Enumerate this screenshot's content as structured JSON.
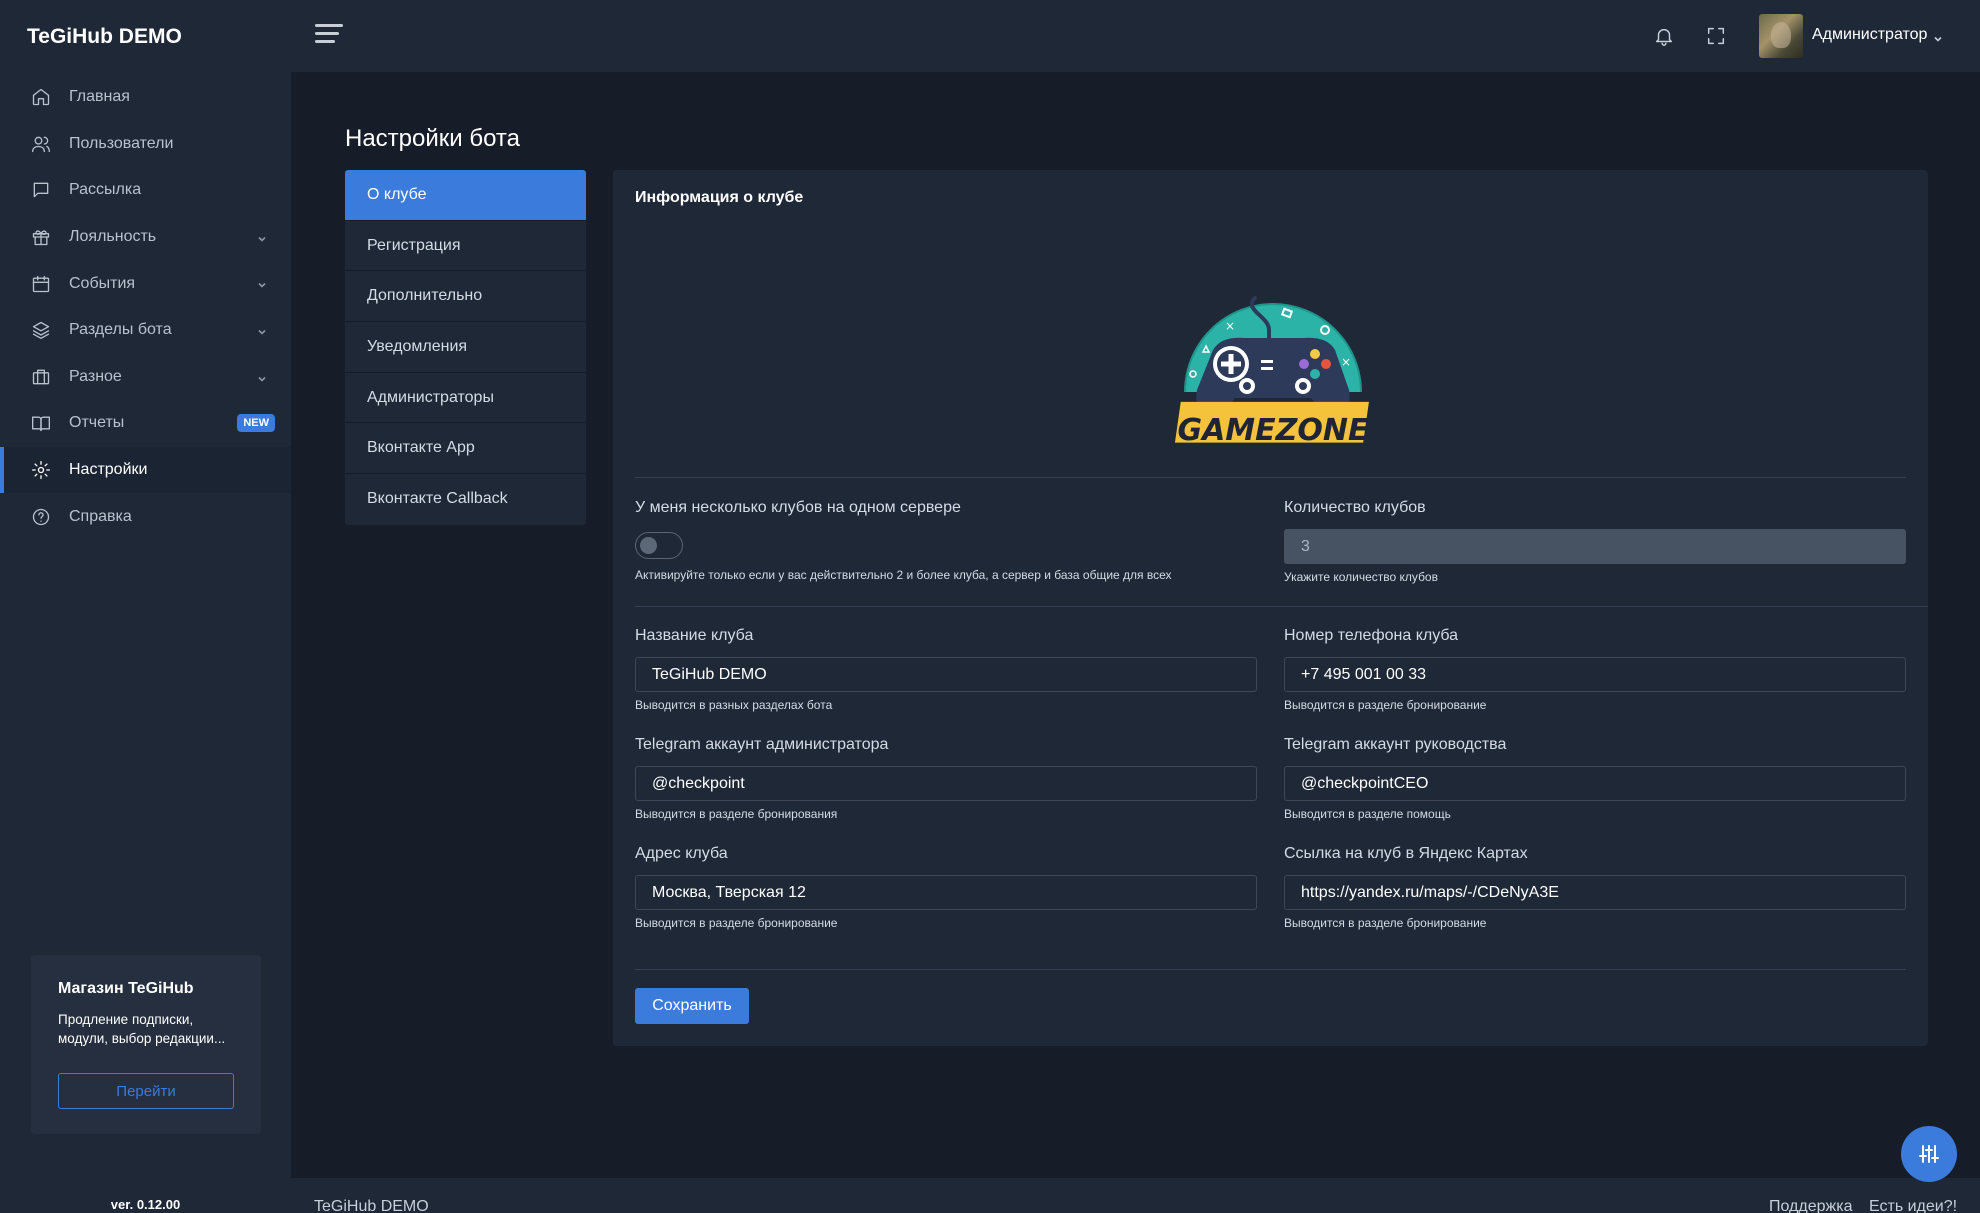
{
  "brand": "TeGiHub DEMO",
  "sidebar": {
    "items": [
      {
        "label": "Главная",
        "icon": "home-icon"
      },
      {
        "label": "Пользователи",
        "icon": "users-icon"
      },
      {
        "label": "Рассылка",
        "icon": "message-icon"
      },
      {
        "label": "Лояльность",
        "icon": "gift-icon",
        "expandable": true
      },
      {
        "label": "События",
        "icon": "calendar-icon",
        "expandable": true
      },
      {
        "label": "Разделы бота",
        "icon": "layers-icon",
        "expandable": true
      },
      {
        "label": "Разное",
        "icon": "briefcase-icon",
        "expandable": true
      },
      {
        "label": "Отчеты",
        "icon": "book-icon",
        "badge": "NEW"
      },
      {
        "label": "Настройки",
        "icon": "gear-icon",
        "active": true
      },
      {
        "label": "Справка",
        "icon": "help-icon"
      }
    ],
    "shop": {
      "title": "Магазин TeGiHub",
      "text": "Продление подписки, модули, выбор редакции...",
      "button": "Перейти"
    },
    "version": "ver. 0.12.00"
  },
  "topbar": {
    "user": "Администратор"
  },
  "page": {
    "title": "Настройки бота",
    "tabs": [
      {
        "label": "О клубе",
        "active": true
      },
      {
        "label": "Регистрация"
      },
      {
        "label": "Дополнительно"
      },
      {
        "label": "Уведомления"
      },
      {
        "label": "Администраторы"
      },
      {
        "label": "Вконтакте App"
      },
      {
        "label": "Вконтакте Callback"
      }
    ]
  },
  "card": {
    "title": "Информация о клубе",
    "logo_text": "GAMEZONE",
    "multi_club": {
      "label": "У меня несколько клубов на одном сервере",
      "hint": "Активируйте только если у вас действительно 2 и более клуба, а сервер и база общие для всех",
      "enabled": false
    },
    "club_count": {
      "label": "Количество клубов",
      "value": "3",
      "hint": "Укажите количество клубов"
    },
    "club_name": {
      "label": "Название клуба",
      "value": "TeGiHub DEMO",
      "hint": "Выводится в разных разделах бота"
    },
    "club_phone": {
      "label": "Номер телефона клуба",
      "value": "+7 495 001 00 33",
      "hint": "Выводится в разделе бронирование"
    },
    "admin_telegram": {
      "label": "Telegram аккаунт администратора",
      "value": "@checkpoint",
      "hint": "Выводится в разделе бронирования"
    },
    "mgmt_telegram": {
      "label": "Telegram аккаунт руководства",
      "value": "@checkpointCEO",
      "hint": "Выводится в разделе помощь"
    },
    "address": {
      "label": "Адрес клуба",
      "value": "Москва, Тверская 12",
      "hint": "Выводится в разделе бронирование"
    },
    "yandex_link": {
      "label": "Ссылка на клуб в Яндекс Картах",
      "value": "https://yandex.ru/maps/-/CDeNyA3E",
      "hint": "Выводится в разделе бронирование"
    },
    "save_label": "Сохранить"
  },
  "footer": {
    "brand": "TeGiHub DEMO",
    "support": "Поддержка",
    "ideas": "Есть идеи?!"
  },
  "colors": {
    "accent": "#3a7bdc",
    "sidebar_bg": "#1e2837",
    "page_bg": "#161d29"
  }
}
